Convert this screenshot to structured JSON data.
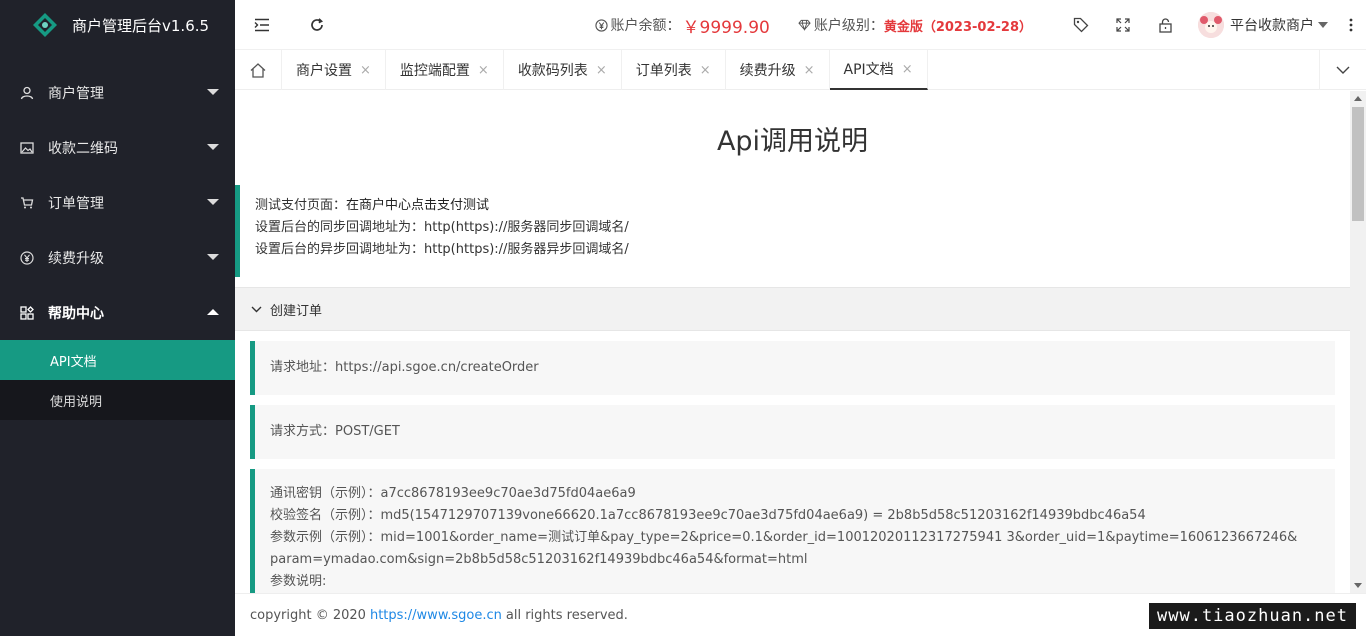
{
  "app": {
    "title": "商户管理后台v1.6.5"
  },
  "sidebar": {
    "items": [
      {
        "label": "商户管理",
        "icon": "user-icon"
      },
      {
        "label": "收款二维码",
        "icon": "image-icon"
      },
      {
        "label": "订单管理",
        "icon": "cart-icon"
      },
      {
        "label": "续费升级",
        "icon": "yen-icon"
      },
      {
        "label": "帮助中心",
        "icon": "apps-icon",
        "expanded": true
      }
    ],
    "submenu": [
      {
        "label": "API文档",
        "current": true
      },
      {
        "label": "使用说明",
        "current": false
      }
    ]
  },
  "header": {
    "balance_label": "账户余额：",
    "balance_value": "￥9999.90",
    "level_label": "账户级别：",
    "level_value": "黄金版（2023-02-28）",
    "user_name": "平台收款商户",
    "accent_color": "#169a83",
    "alert_color": "#e4393c"
  },
  "tabs": [
    {
      "label": "商户设置"
    },
    {
      "label": "监控端配置"
    },
    {
      "label": "收款码列表"
    },
    {
      "label": "订单列表"
    },
    {
      "label": "续费升级"
    },
    {
      "label": "API文档",
      "active": true
    }
  ],
  "tab_close": "×",
  "content": {
    "title": "Api调用说明",
    "intro": {
      "line1_prefix": "测试支付页面：",
      "line1_strong": "在商户中心点击支付测试",
      "line2": "设置后台的同步回调地址为：http(https)://服务器同步回调域名/",
      "line3": "设置后台的异步回调地址为：http(https)://服务器异步回调域名/"
    },
    "section": {
      "title": "创建订单",
      "request_url": "请求地址：https://api.sgoe.cn/createOrder",
      "request_method": "请求方式：POST/GET",
      "key_example": "通讯密钥（示例）：a7cc8678193ee9c70ae3d75fd04ae6a9",
      "sign_example": "校验签名（示例）：md5(1547129707139vone66620.1a7cc8678193ee9c70ae3d75fd04ae6a9) = 2b8b5d58c51203162f14939bdbc46a54",
      "param_example": "参数示例（示例）：mid=1001&order_name=测试订单&pay_type=2&price=0.1&order_id=10012020112317275941 3&order_uid=1&paytime=1606123667246&",
      "param_example_cont": "param=ymadao.com&sign=2b8b5d58c51203162f14939bdbc46a54&format=html",
      "param_desc": "参数说明:"
    }
  },
  "footer": {
    "prefix": "copyright © 2020",
    "link": "https://www.sgoe.cn",
    "suffix": "all rights reserved."
  },
  "watermark": "www.tiaozhuan.net"
}
